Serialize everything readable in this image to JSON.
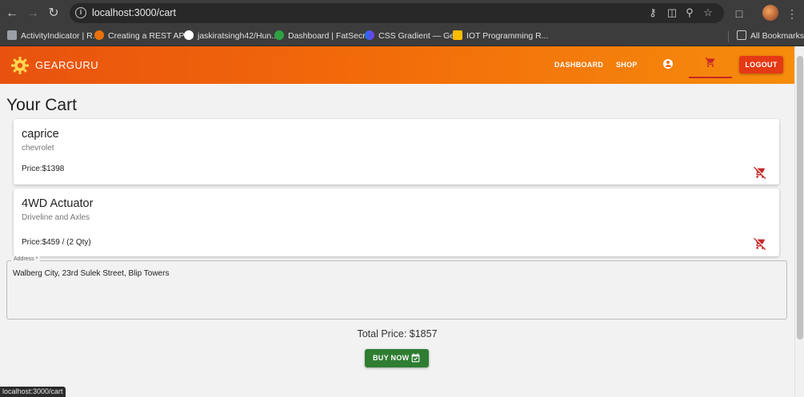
{
  "browser": {
    "url": "localhost:3000/cart",
    "bookmarks": [
      {
        "label": "ActivityIndicator | R...",
        "color": "#9aa0a6"
      },
      {
        "label": "Creating a REST API...",
        "color": "#e8710a"
      },
      {
        "label": "jaskiratsingh42/Hun...",
        "color": "#ffffff"
      },
      {
        "label": "Dashboard | FatSecr...",
        "color": "#2ea043"
      },
      {
        "label": "CSS Gradient — Ge...",
        "color": "#3b5bdb"
      },
      {
        "label": "IOT Programming R...",
        "color": "#fbbc04"
      }
    ],
    "all_bookmarks": "All Bookmarks",
    "status_url": "localhost:3000/cart"
  },
  "app": {
    "brand": "GEARGURU",
    "brand_color": "#f26a0a",
    "nav": {
      "dashboard": "DASHBOARD",
      "shop": "SHOP",
      "logout": "LOGOUT"
    }
  },
  "cart": {
    "title": "Your Cart",
    "items": [
      {
        "name": "caprice",
        "category": "chevrolet",
        "price": "Price:$1398"
      },
      {
        "name": "4WD Actuator",
        "category": "Driveline and Axles",
        "price": "Price:$459 / (2 Qty)"
      }
    ],
    "address_label": "Address *",
    "address_value": "Walberg City, 23rd Sulek Street, Blip Towers",
    "total": "Total Price: $1857",
    "buy_label": "BUY NOW",
    "buy_color": "#2e7d32",
    "remove_color": "#c62828"
  }
}
